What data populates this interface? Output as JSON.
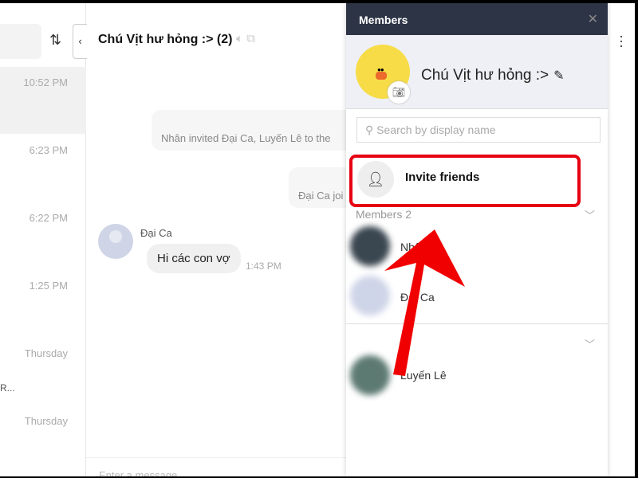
{
  "conversation_list": {
    "times": [
      "10:52 PM",
      "6:23 PM",
      "6:22 PM",
      "1:25 PM",
      "Thursday",
      "Thursday"
    ],
    "truncated_text": "R..."
  },
  "chat": {
    "title": "Chú Vịt hư hỏng :> (2)",
    "system_messages": [
      "Nhân invited Đại Ca, Luyến Lê to the",
      "Đại Ca joi"
    ],
    "sender": "Đại Ca",
    "message": "Hi các con vợ",
    "message_time": "1:43 PM",
    "input_placeholder": "Enter a message"
  },
  "members_panel": {
    "title": "Members",
    "group_name": "Chú Vịt hư hỏng :>",
    "search_placeholder": "Search by display name",
    "invite_label": "Invite friends",
    "section_label": "Members 2",
    "members": [
      {
        "name": "Nhân",
        "color": "#3a4650"
      },
      {
        "name": "Đại Ca",
        "color": "#cfd5e8"
      },
      {
        "name": "Luyến Lê",
        "color": "#5d7a72"
      }
    ]
  },
  "colors": {
    "header": "#2d3446",
    "highlight": "#e60012",
    "accent_arrow": "#f00000"
  }
}
